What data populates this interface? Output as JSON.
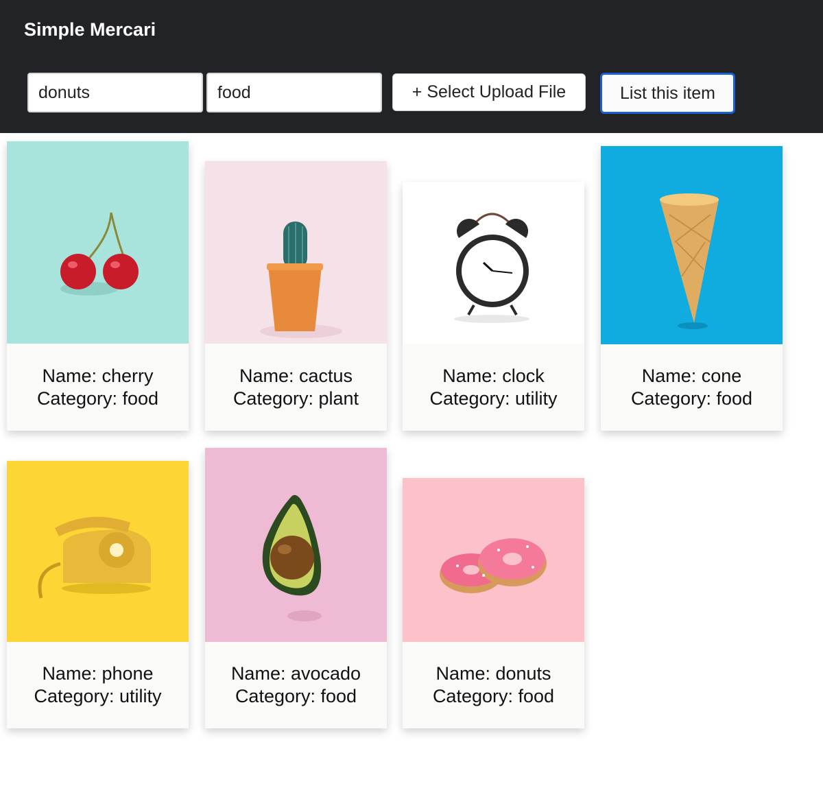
{
  "app": {
    "title": "Simple Mercari"
  },
  "form": {
    "name_value": "donuts",
    "category_value": "food",
    "upload_label": "+ Select Upload File",
    "submit_label": "List this item"
  },
  "items": [
    {
      "name": "Name: cherry",
      "category": "Category: food",
      "image": "cherry",
      "bg": "#a9e4dc"
    },
    {
      "name": "Name: cactus",
      "category": "Category: plant",
      "image": "cactus",
      "bg": "#f5e2e8"
    },
    {
      "name": "Name: clock",
      "category": "Category: utility",
      "image": "alarm-clock",
      "bg": "#ffffff"
    },
    {
      "name": "Name: cone",
      "category": "Category: food",
      "image": "ice-cream-cone",
      "bg": "#10ace0"
    },
    {
      "name": "Name: phone",
      "category": "Category: utility",
      "image": "rotary-phone",
      "bg": "#fdd535"
    },
    {
      "name": "Name: avocado",
      "category": "Category: food",
      "image": "avocado",
      "bg": "#efbad3"
    },
    {
      "name": "Name: donuts",
      "category": "Category: food",
      "image": "donuts",
      "bg": "#fdc2c9"
    }
  ]
}
